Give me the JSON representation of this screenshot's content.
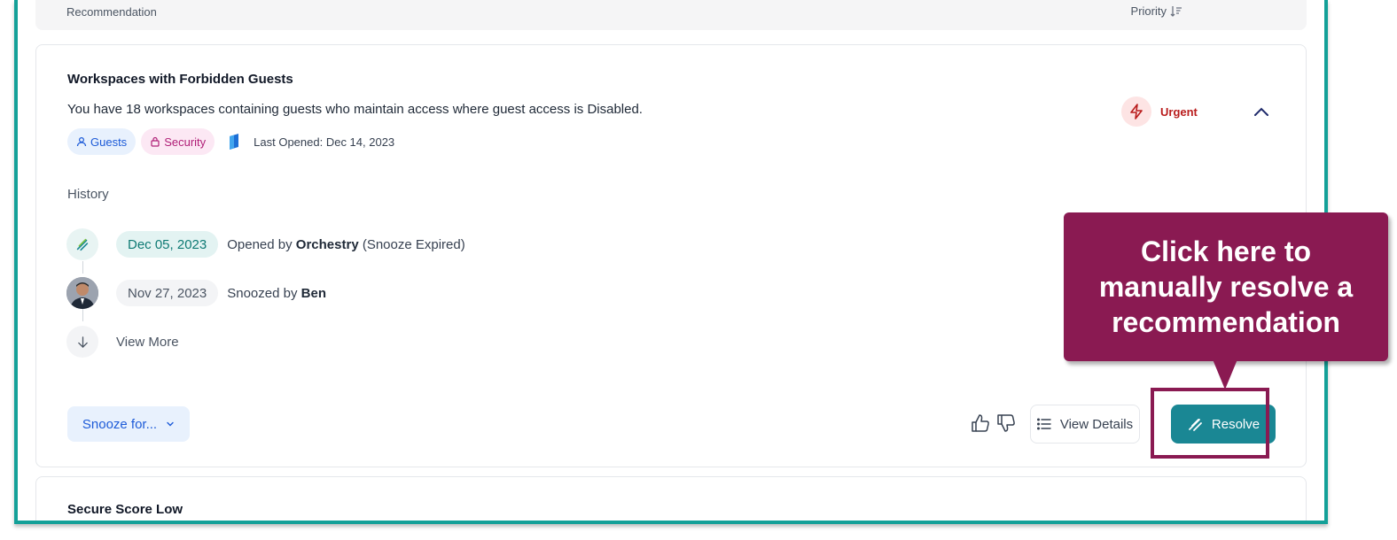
{
  "header": {
    "recommendation_label": "Recommendation",
    "priority_label": "Priority",
    "sort_icon": "sort-desc-icon"
  },
  "card": {
    "title": "Workspaces with Forbidden Guests",
    "description": "You have 18 workspaces containing guests who maintain access where guest access is Disabled.",
    "tags": [
      {
        "label": "Guests",
        "icon": "user-icon",
        "color": "#1d5bd8"
      },
      {
        "label": "Security",
        "icon": "lock-icon",
        "color": "#b01f77"
      }
    ],
    "app_icon": "sharepoint-icon",
    "last_opened": "Last Opened: Dec 14, 2023",
    "priority": {
      "label": "Urgent",
      "icon": "lightning-icon",
      "color": "#b91c1c"
    },
    "history_label": "History",
    "history": [
      {
        "date": "Dec 05, 2023",
        "prefix": "Opened by ",
        "actor": "Orchestry",
        "suffix": " (Snooze Expired)"
      },
      {
        "date": "Nov 27, 2023",
        "prefix": "Snoozed by ",
        "actor": "Ben",
        "suffix": ""
      }
    ],
    "view_more": "View More",
    "snooze_label": "Snooze for...",
    "view_details_label": "View Details",
    "resolve_label": "Resolve"
  },
  "card2": {
    "title": "Secure Score Low"
  },
  "tooltip": {
    "text": "Click here to manually resolve a recommendation"
  },
  "colors": {
    "frame": "#14a098",
    "resolve": "#1a8794",
    "tooltip": "#8a1a52"
  }
}
